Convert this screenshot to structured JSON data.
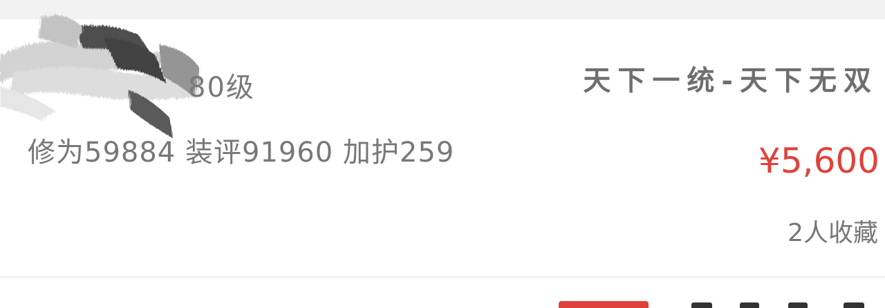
{
  "listing": {
    "level": "80级",
    "stats": "修为59884 装评91960 加护259",
    "server": "天下一统-天下无双",
    "price": "¥5,600",
    "favorites": "2人收藏"
  },
  "colors": {
    "price": "#e0413b",
    "text_gray": "#777777",
    "separator": "#f2f2f2"
  },
  "avatar": {
    "style": "ink-brush-stroke"
  }
}
